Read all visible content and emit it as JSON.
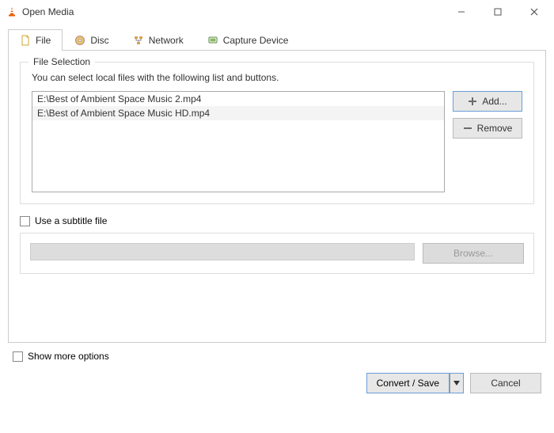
{
  "window": {
    "title": "Open Media"
  },
  "tabs": {
    "file": "File",
    "disc": "Disc",
    "network": "Network",
    "capture": "Capture Device"
  },
  "file_selection": {
    "legend": "File Selection",
    "hint": "You can select local files with the following list and buttons.",
    "files": [
      "E:\\Best of Ambient Space Music 2.mp4",
      "E:\\Best of Ambient Space Music HD.mp4"
    ],
    "add_label": "Add...",
    "remove_label": "Remove"
  },
  "subtitle": {
    "checkbox_label": "Use a subtitle file",
    "browse_label": "Browse..."
  },
  "footer": {
    "show_more_label": "Show more options",
    "convert_label": "Convert / Save",
    "cancel_label": "Cancel"
  }
}
